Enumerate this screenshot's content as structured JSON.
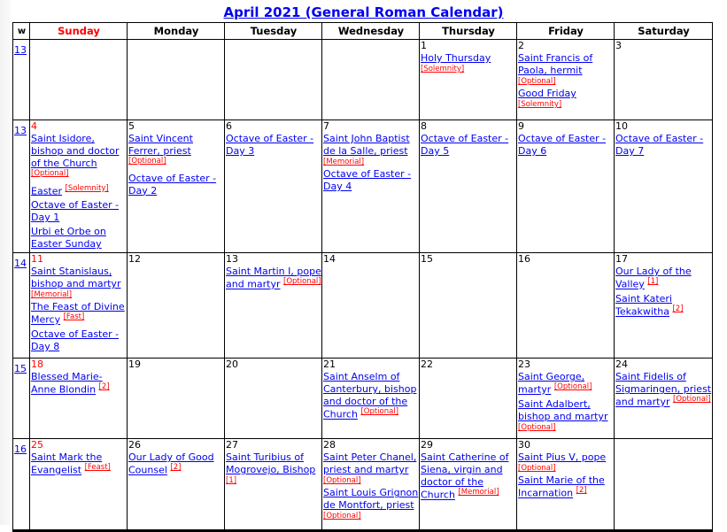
{
  "title": "April 2021 (General Roman Calendar)",
  "colors": {
    "link": "#0000ee",
    "sunday": "#ff0000",
    "rank": "#ff0000",
    "text": "#000000"
  },
  "headers": [
    "w",
    "Sunday",
    "Monday",
    "Tuesday",
    "Wednesday",
    "Thursday",
    "Friday",
    "Saturday"
  ],
  "weeks": [
    {
      "week": "13",
      "days": [
        {
          "num": "",
          "events": []
        },
        {
          "num": "",
          "events": []
        },
        {
          "num": "",
          "events": []
        },
        {
          "num": "",
          "events": []
        },
        {
          "num": "1",
          "events": [
            {
              "name": "Holy Thursday",
              "rank": "[Solemnity]",
              "rank_block": true
            }
          ]
        },
        {
          "num": "2",
          "events": [
            {
              "name": "Saint Francis of Paola, hermit",
              "rank": "[Optional]",
              "rank_block": true
            },
            {
              "name": "Good Friday",
              "rank": "[Solemnity]",
              "rank_block": true
            }
          ]
        },
        {
          "num": "3",
          "events": []
        }
      ]
    },
    {
      "week": "13",
      "days": [
        {
          "num": "4",
          "events": [
            {
              "name": "Saint Isidore, bishop and doctor of the Church",
              "rank": "[Optional]"
            },
            {
              "name": "Easter",
              "rank": "[Solemnity]"
            },
            {
              "name": "Octave of Easter - Day 1",
              "rank": ""
            },
            {
              "name": "Urbi et Orbe on Easter Sunday",
              "rank": ""
            }
          ]
        },
        {
          "num": "5",
          "events": [
            {
              "name": "Saint Vincent Ferrer, priest",
              "rank": "[Optional]"
            },
            {
              "name": "Octave of Easter - Day 2",
              "rank": ""
            }
          ]
        },
        {
          "num": "6",
          "events": [
            {
              "name": "Octave of Easter - Day 3",
              "rank": ""
            }
          ]
        },
        {
          "num": "7",
          "events": [
            {
              "name": "Saint John Baptist de la Salle, priest",
              "rank": "[Memorial]",
              "rank_block": true
            },
            {
              "name": "Octave of Easter - Day 4",
              "rank": ""
            }
          ]
        },
        {
          "num": "8",
          "events": [
            {
              "name": "Octave of Easter - Day 5",
              "rank": ""
            }
          ]
        },
        {
          "num": "9",
          "events": [
            {
              "name": "Octave of Easter - Day 6",
              "rank": ""
            }
          ]
        },
        {
          "num": "10",
          "events": [
            {
              "name": "Octave of Easter - Day 7",
              "rank": ""
            }
          ]
        }
      ]
    },
    {
      "week": "14",
      "days": [
        {
          "num": "11",
          "events": [
            {
              "name": "Saint Stanislaus, bishop and martyr",
              "rank": "[Memorial]",
              "rank_block": true
            },
            {
              "name": "The Feast of Divine Mercy",
              "rank": "[Fast]"
            },
            {
              "name": "Octave of Easter - Day 8",
              "rank": ""
            }
          ]
        },
        {
          "num": "12",
          "events": []
        },
        {
          "num": "13",
          "events": [
            {
              "name": "Saint Martin I, pope and martyr",
              "rank": "[Optional]"
            }
          ]
        },
        {
          "num": "14",
          "events": []
        },
        {
          "num": "15",
          "events": []
        },
        {
          "num": "16",
          "events": []
        },
        {
          "num": "17",
          "events": [
            {
              "name": "Our Lady of the Valley",
              "rank": "[1]"
            },
            {
              "name": "Saint Kateri Tekakwitha",
              "rank": "[2]"
            }
          ]
        }
      ]
    },
    {
      "week": "15",
      "days": [
        {
          "num": "18",
          "events": [
            {
              "name": "Blessed Marie-Anne Blondin",
              "rank": "[2]"
            }
          ]
        },
        {
          "num": "19",
          "events": []
        },
        {
          "num": "20",
          "events": []
        },
        {
          "num": "21",
          "events": [
            {
              "name": "Saint Anselm of Canterbury, bishop and doctor of the Church",
              "rank": "[Optional]"
            }
          ]
        },
        {
          "num": "22",
          "events": []
        },
        {
          "num": "23",
          "events": [
            {
              "name": "Saint George, martyr",
              "rank": "[Optional]"
            },
            {
              "name": "Saint Adalbert, bishop and martyr",
              "rank": "[Optional]",
              "rank_block": true
            }
          ]
        },
        {
          "num": "24",
          "events": [
            {
              "name": "Saint Fidelis of Sigmaringen, priest and martyr",
              "rank": "[Optional]"
            }
          ]
        }
      ]
    },
    {
      "week": "16",
      "days": [
        {
          "num": "25",
          "events": [
            {
              "name": "Saint Mark the Evangelist",
              "rank": "[Feast]"
            }
          ]
        },
        {
          "num": "26",
          "events": [
            {
              "name": "Our Lady of Good Counsel",
              "rank": "[2]"
            }
          ]
        },
        {
          "num": "27",
          "events": [
            {
              "name": "Saint Turibius of Mogrovejo, Bishop",
              "rank": "[1]",
              "rank_block": true
            }
          ]
        },
        {
          "num": "28",
          "events": [
            {
              "name": "Saint Peter Chanel, priest and martyr",
              "rank": "[Optional]",
              "rank_block": true
            },
            {
              "name": "Saint Louis Grignon de Montfort, priest",
              "rank": "[Optional]",
              "rank_block": true
            }
          ]
        },
        {
          "num": "29",
          "events": [
            {
              "name": "Saint Catherine of Siena, virgin and doctor of the Church",
              "rank": "[Memorial]"
            }
          ]
        },
        {
          "num": "30",
          "events": [
            {
              "name": "Saint Pius V, pope",
              "rank": "[Optional]",
              "rank_block": true
            },
            {
              "name": "Saint Marie of the Incarnation",
              "rank": "[2]"
            }
          ]
        },
        {
          "num": "",
          "events": []
        }
      ]
    }
  ]
}
